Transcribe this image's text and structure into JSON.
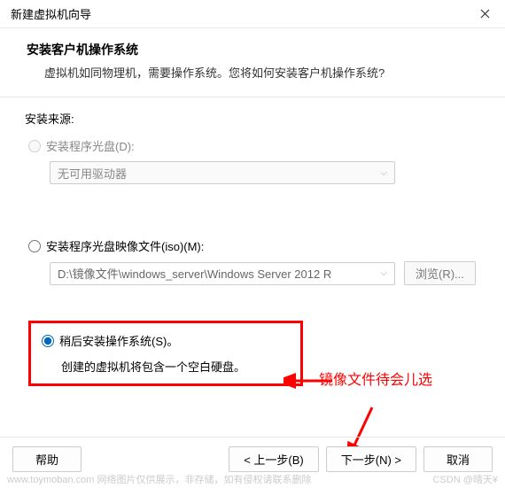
{
  "window": {
    "title": "新建虚拟机向导"
  },
  "header": {
    "title": "安装客户机操作系统",
    "subtitle": "虚拟机如同物理机，需要操作系统。您将如何安装客户机操作系统?"
  },
  "source_label": "安装来源:",
  "options": {
    "disc": {
      "label": "安装程序光盘(D):",
      "drive_placeholder": "无可用驱动器"
    },
    "iso": {
      "label": "安装程序光盘映像文件(iso)(M):",
      "path": "D:\\镜像文件\\windows_server\\Windows Server 2012 R",
      "browse": "浏览(R)..."
    },
    "later": {
      "label": "稍后安装操作系统(S)。",
      "hint": "创建的虚拟机将包含一个空白硬盘。"
    }
  },
  "annotation": "镜像文件待会儿选",
  "footer": {
    "help": "帮助",
    "back": "< 上一步(B)",
    "next": "下一步(N) >",
    "cancel": "取消"
  },
  "watermark_left": "www.toymoban.com  网络图片仅供展示，非存储，如有侵权请联系删除",
  "watermark_right": "CSDN @晴天¥"
}
